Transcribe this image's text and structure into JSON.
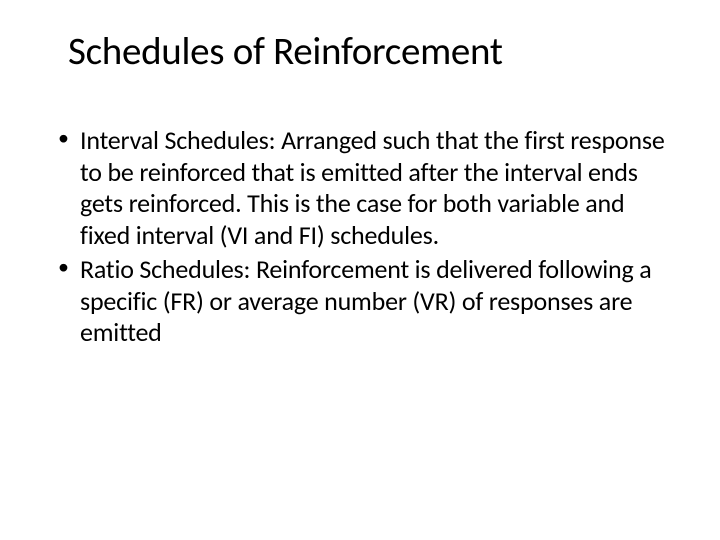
{
  "slide": {
    "title": "Schedules of Reinforcement",
    "bullets": [
      "Interval Schedules:  Arranged such that the first response to be reinforced that is emitted after the interval ends gets reinforced. This is the case for both variable and fixed interval (VI and FI) schedules.",
      "Ratio Schedules: Reinforcement is delivered following a specific (FR) or average number (VR) of responses are emitted"
    ]
  }
}
